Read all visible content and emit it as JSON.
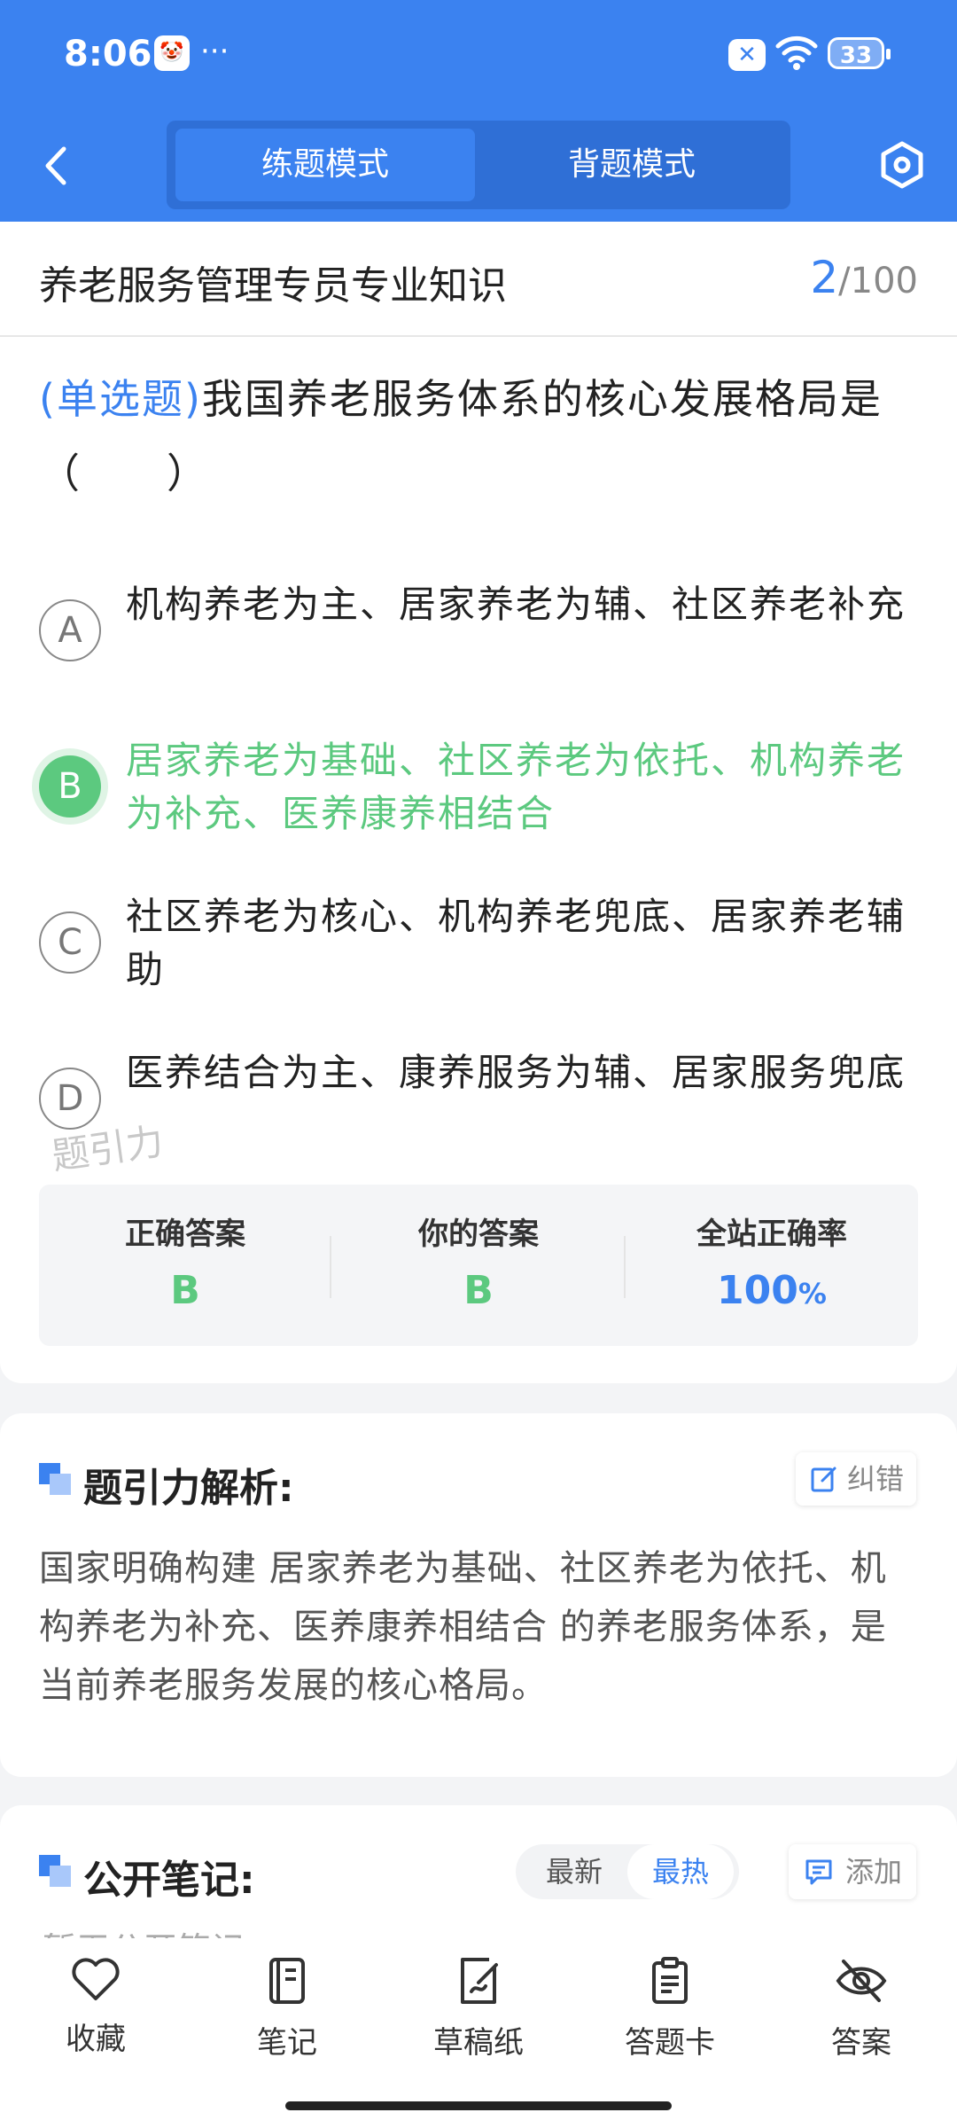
{
  "status": {
    "time": "8:06",
    "app_badge": "🤡",
    "more": "···",
    "battery": "33"
  },
  "nav": {
    "tab_practice": "练题模式",
    "tab_memorize": "背题模式"
  },
  "header": {
    "title": "养老服务管理专员专业知识",
    "current": "2",
    "separator": "/",
    "total": "100"
  },
  "question": {
    "type": "(单选题)",
    "text": "我国养老服务体系的核心发展格局是（　　）",
    "options": [
      {
        "letter": "A",
        "text": "机构养老为主、居家养老为辅、社区养老补充"
      },
      {
        "letter": "B",
        "text": "居家养老为基础、社区养老为依托、机构养老为补充、医养康养相结合"
      },
      {
        "letter": "C",
        "text": "社区养老为核心、机构养老兜底、居家养老辅助"
      },
      {
        "letter": "D",
        "text": "医养结合为主、康养服务为辅、居家服务兜底"
      }
    ],
    "watermark": "题引力"
  },
  "stats": {
    "correct_label": "正确答案",
    "correct_value": "B",
    "yours_label": "你的答案",
    "yours_value": "B",
    "rate_label": "全站正确率",
    "rate_value": "100",
    "rate_unit": "%"
  },
  "analysis": {
    "title": "题引力解析:",
    "report_label": "纠错",
    "text": "国家明确构建 居家养老为基础、社区养老为依托、机构养老为补充、医养康养相结合 的养老服务体系，是当前养老服务发展的核心格局。"
  },
  "notes": {
    "title": "公开笔记:",
    "sort_latest": "最新",
    "sort_hot": "最热",
    "add_label": "添加",
    "empty": "暂无公开笔记"
  },
  "bottom": {
    "favorite": "收藏",
    "notes": "笔记",
    "scratch": "草稿纸",
    "answer_card": "答题卡",
    "answer": "答案"
  },
  "colors": {
    "primary": "#3b82f0",
    "correct": "#5cc97f"
  }
}
